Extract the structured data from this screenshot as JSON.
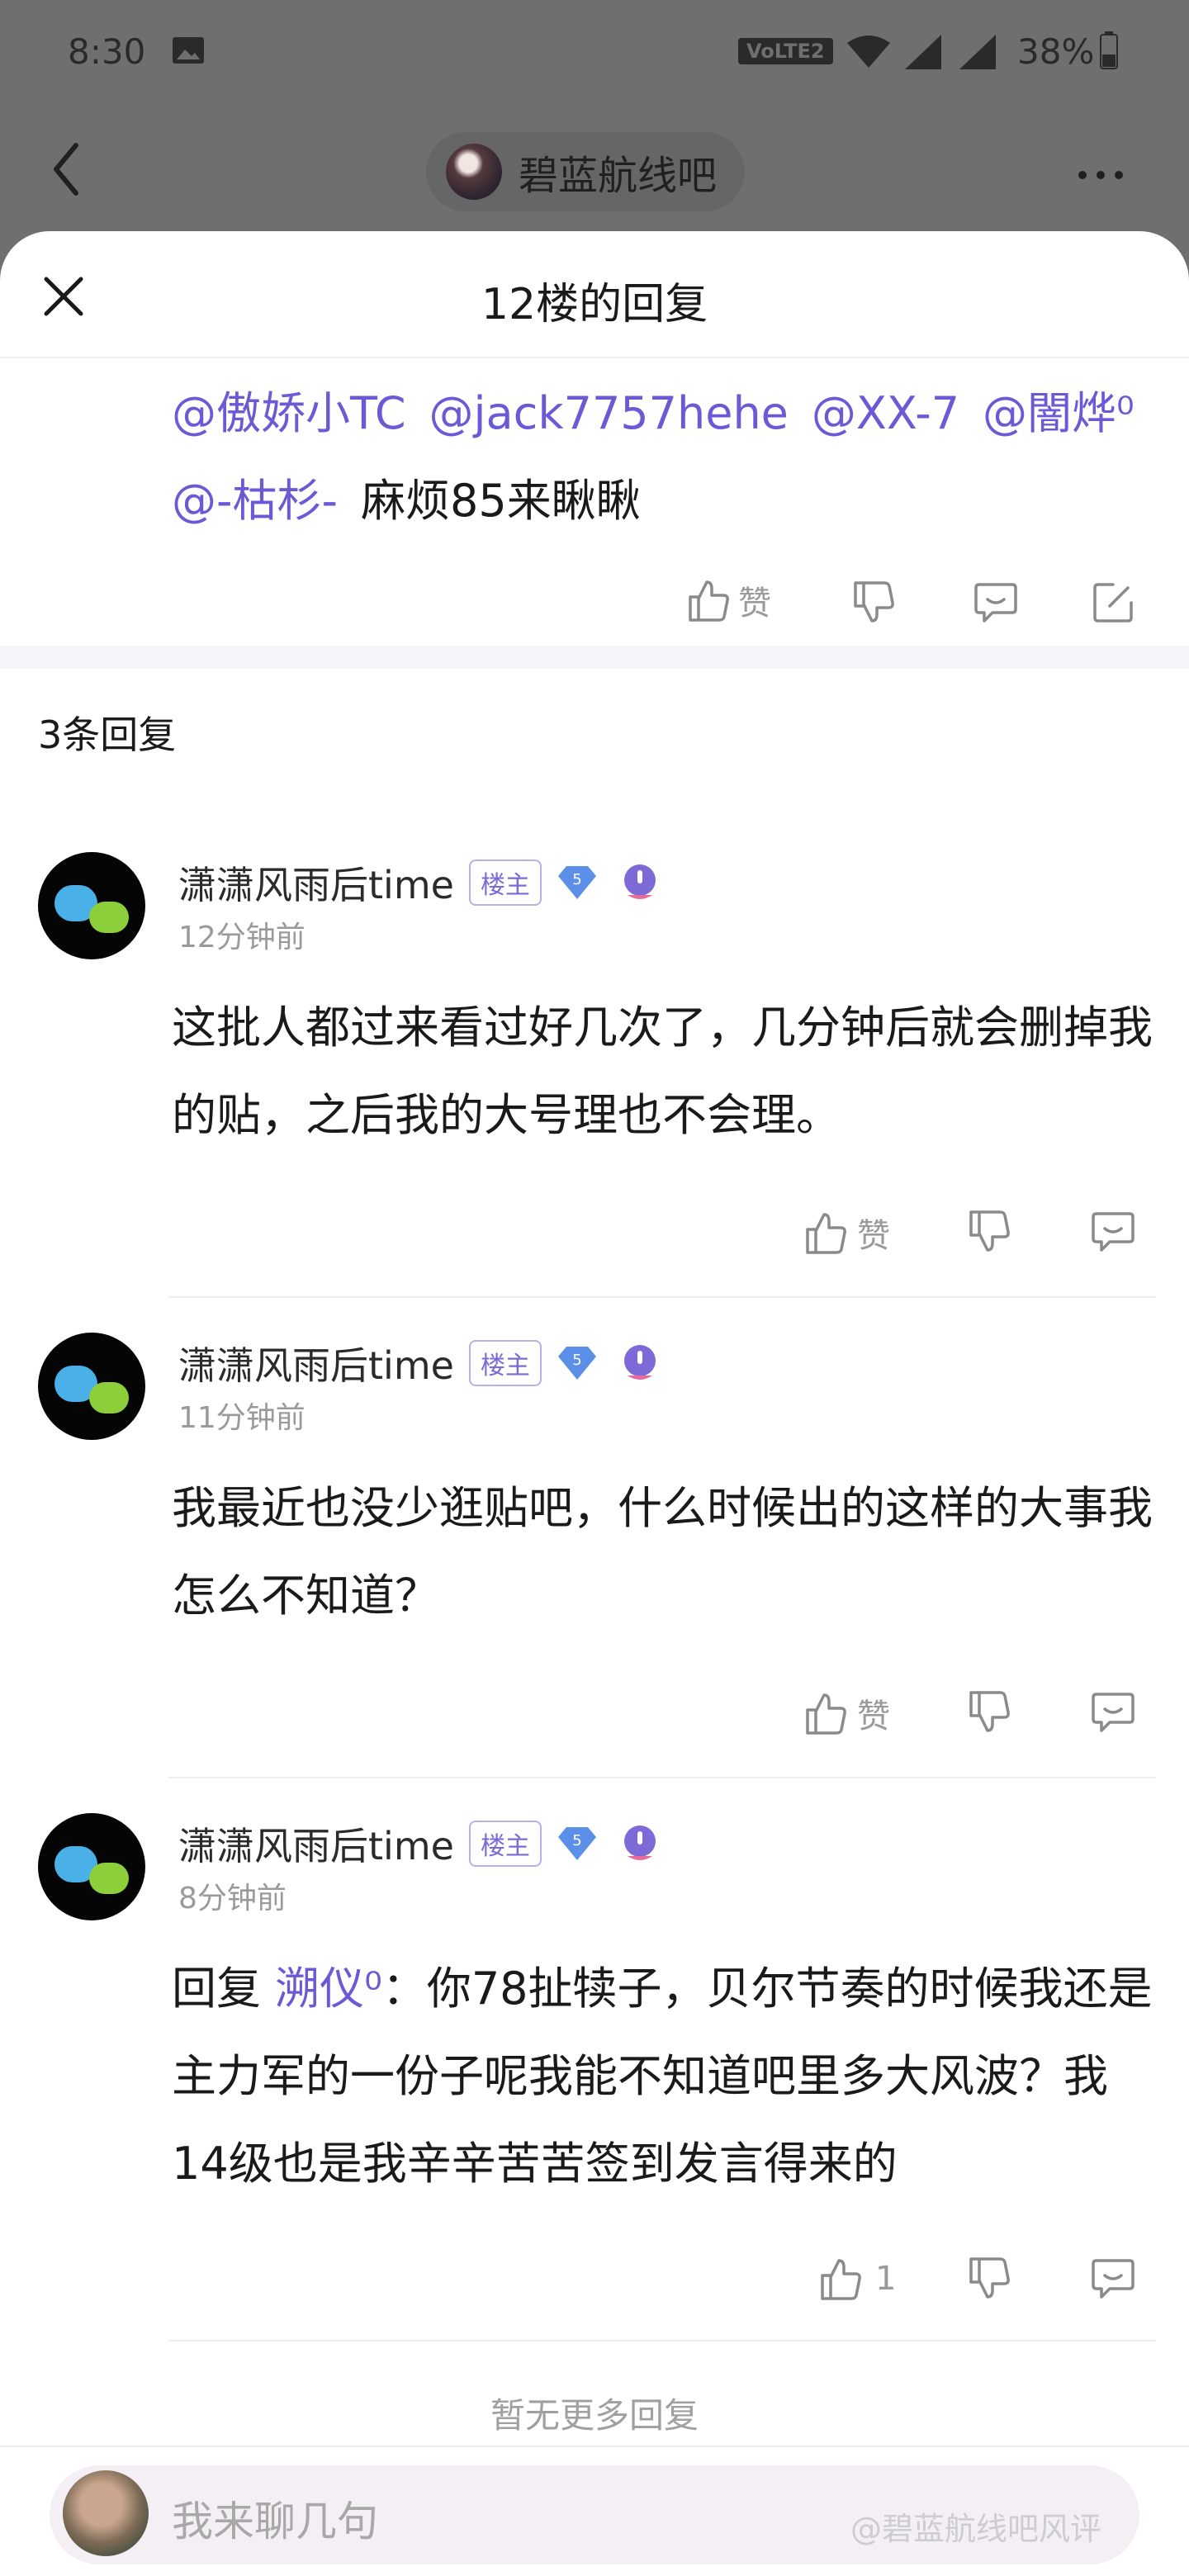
{
  "status_bar": {
    "time": "8:30",
    "network": "VoLTE2",
    "battery": "38%"
  },
  "nav": {
    "forum_name": "碧蓝航线吧"
  },
  "sheet": {
    "title": "12楼的回复"
  },
  "op": {
    "mentions": [
      "@傲娇小TC",
      "@jack7757hehe",
      "@XX-7",
      "@闇烨⁰",
      "@-枯杉-"
    ],
    "text": "麻烦85来瞅瞅",
    "like_label": "赞"
  },
  "reply_count": "3条回复",
  "replies": [
    {
      "name": "潇潇风雨后time",
      "badge": "楼主",
      "level": "5",
      "time": "12分钟前",
      "content": "这批人都过来看过好几次了，几分钟后就会删掉我的贴，之后我的大号理也不会理。",
      "like_label": "赞"
    },
    {
      "name": "潇潇风雨后time",
      "badge": "楼主",
      "level": "5",
      "time": "11分钟前",
      "content": "我最近也没少逛贴吧，什么时候出的这样的大事我怎么不知道？",
      "like_label": "赞"
    },
    {
      "name": "潇潇风雨后time",
      "badge": "楼主",
      "level": "5",
      "time": "8分钟前",
      "reply_prefix": "回复 ",
      "reply_to": "溯仪⁰",
      "content": "：你78扯犊子，贝尔节奏的时候我还是主力军的一份子呢我能不知道吧里多大风波？我14级也是我辛辛苦苦签到发言得来的",
      "like_label": "1"
    }
  ],
  "no_more": "暂无更多回复",
  "input": {
    "placeholder": "我来聊几句"
  },
  "watermark": "@碧蓝航线吧风评",
  "colors": {
    "accent": "#6b5ad6",
    "badge": "#7a6ad8",
    "diamond": "#5b8fe8",
    "level_pin": "#7d6ad6"
  }
}
